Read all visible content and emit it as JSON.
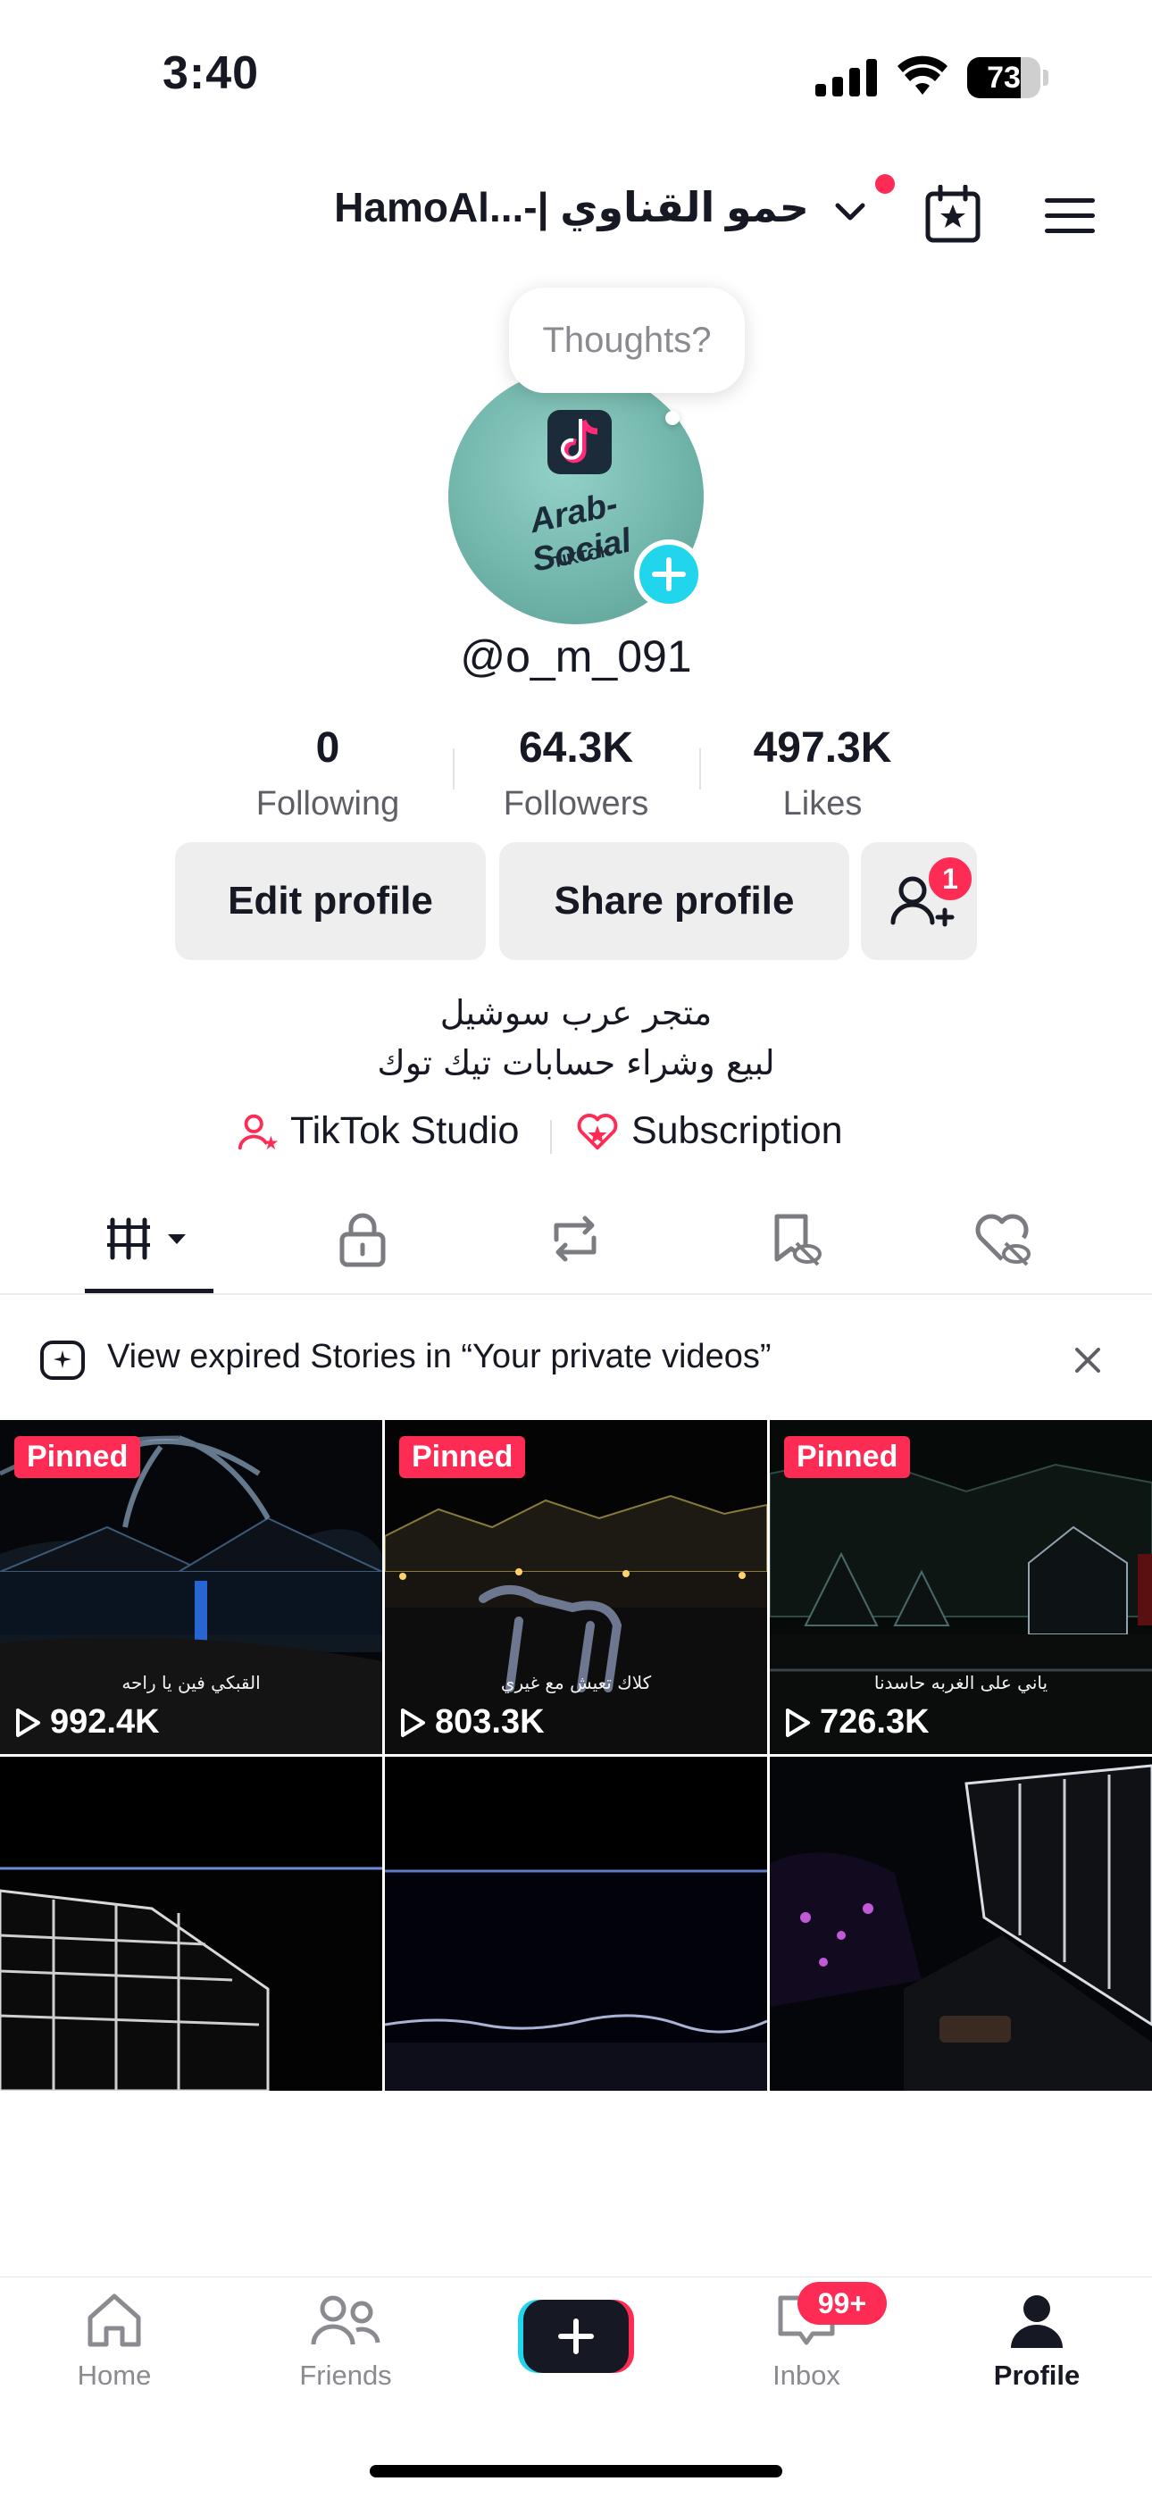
{
  "status_bar": {
    "time": "3:40",
    "battery": "73",
    "battery_level": 0.73
  },
  "header": {
    "title": "HamoAl...-| حمو القناوي",
    "has_notification_dot": true
  },
  "profile": {
    "thoughts_placeholder": "Thoughts?",
    "avatar_text": "Arab-Social",
    "avatar_subtext": "TIKTOK",
    "username": "@o_m_091"
  },
  "stats": [
    {
      "value": "0",
      "label": "Following"
    },
    {
      "value": "64.3K",
      "label": "Followers"
    },
    {
      "value": "497.3K",
      "label": "Likes"
    }
  ],
  "buttons": {
    "edit": "Edit profile",
    "share": "Share profile",
    "friend_badge": "1"
  },
  "bio": {
    "line1": "متجر عرب سوشيل",
    "line2": "لبيع وشراء حسابات تيك توك"
  },
  "links": {
    "studio": "TikTok Studio",
    "subscription": "Subscription"
  },
  "tabs": [
    "videos-icon",
    "lock-icon",
    "repost-icon",
    "saved-icon",
    "liked-icon"
  ],
  "stories_banner": {
    "text": "View expired Stories in “Your private videos”"
  },
  "videos": [
    {
      "pinned": "Pinned",
      "views": "992.4K",
      "caption": "القبكي فين يا راحه"
    },
    {
      "pinned": "Pinned",
      "views": "803.3K",
      "caption": "كلاك تعيش مع غيري"
    },
    {
      "pinned": "Pinned",
      "views": "726.3K",
      "caption": "ياني على الغربه حاسدنا"
    },
    {
      "pinned": "",
      "views": "",
      "caption": ""
    },
    {
      "pinned": "",
      "views": "",
      "caption": ""
    },
    {
      "pinned": "",
      "views": "",
      "caption": ""
    }
  ],
  "nav": {
    "home": "Home",
    "friends": "Friends",
    "inbox": "Inbox",
    "inbox_badge": "99+",
    "profile": "Profile"
  },
  "colors": {
    "accent": "#fe2c55",
    "cyan": "#20d5ec",
    "text": "#161823",
    "muted": "#8a8b91"
  }
}
